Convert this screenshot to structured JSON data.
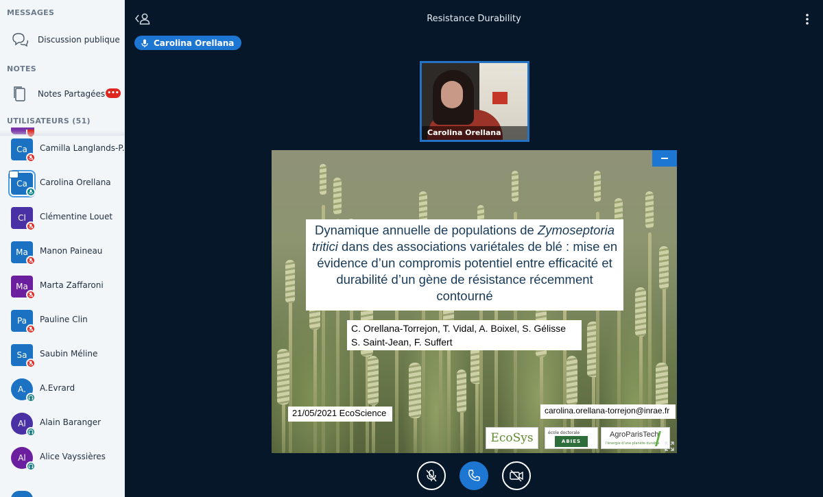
{
  "sidebar": {
    "messages_title": "MESSAGES",
    "public_chat_label": "Discussion publique",
    "notes_title": "NOTES",
    "shared_notes_label": "Notes Partagées",
    "shared_notes_badge": "•••",
    "users_title": "UTILISATEURS (51)",
    "users": [
      {
        "initials": "Ca",
        "name": "Camilla Langlands-P...",
        "color": "#1b72c2",
        "shape": "square",
        "status": "muted"
      },
      {
        "initials": "Ca",
        "name": "Carolina Orellana",
        "color": "#1b72c2",
        "shape": "square",
        "status": "talk",
        "presenter": true
      },
      {
        "initials": "Cl",
        "name": "Clémentine Louet",
        "color": "#4930a5",
        "shape": "square",
        "status": "muted"
      },
      {
        "initials": "Ma",
        "name": "Manon Paineau",
        "color": "#1b72c2",
        "shape": "square",
        "status": "muted"
      },
      {
        "initials": "Ma",
        "name": "Marta Zaffaroni",
        "color": "#6b1f9e",
        "shape": "square",
        "status": "muted"
      },
      {
        "initials": "Pa",
        "name": "Pauline Clin",
        "color": "#1b72c2",
        "shape": "square",
        "status": "muted"
      },
      {
        "initials": "Sa",
        "name": "Saubin Méline",
        "color": "#1b72c2",
        "shape": "square",
        "status": "muted"
      },
      {
        "initials": "A.",
        "name": "A.Evrard",
        "color": "#1b72c2",
        "shape": "round",
        "status": "listen"
      },
      {
        "initials": "Al",
        "name": "Alain Baranger",
        "color": "#4930a5",
        "shape": "round",
        "status": "listen"
      },
      {
        "initials": "Al",
        "name": "Alice Vayssières",
        "color": "#6b1f9e",
        "shape": "round",
        "status": "listen"
      }
    ]
  },
  "header": {
    "title": "Resistance Durability"
  },
  "talking_indicator": {
    "name": "Carolina Orellana"
  },
  "webcam": {
    "name": "Carolina Orellana"
  },
  "slide": {
    "title_part1": "Dynamique annuelle de populations de ",
    "title_italic1": "Zymoseptoria tritici",
    "title_part2": " dans des associations variétales de blé : mise en évidence d’un compromis potentiel entre efficacité et durabilité d’un gène de résistance récemment contourné",
    "authors_line1": "C. Orellana-Torrejon, T. Vidal, A. Boixel, S. Gélisse",
    "authors_line2": "S. Saint-Jean, F. Suffert",
    "date_event": "21/05/2021 EcoScience",
    "email": "carolina.orellana-torrejon@inrae.fr",
    "logo_ecosys": "EcoSys",
    "logo_abies_top": "école doctorale",
    "logo_abies": "ABIES",
    "logo_agroparistech": "AgroParisTech",
    "logo_agroparistech_sub": "l'énergie d'une planète durable"
  },
  "colors": {
    "background": "#06172a",
    "accent": "#1d77d2",
    "muted": "#df2721",
    "talking": "#008081"
  }
}
